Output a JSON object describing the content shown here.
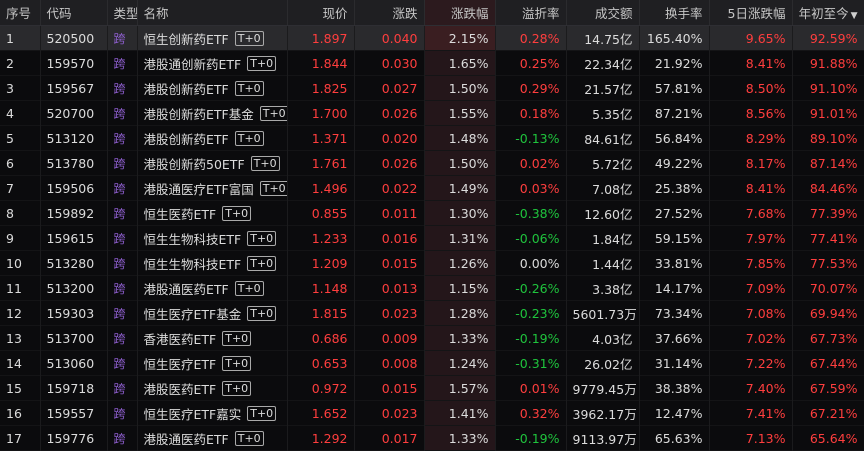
{
  "headers": {
    "seq": "序号",
    "code": "代码",
    "type": "类型",
    "name": "名称",
    "price": "现价",
    "change": "涨跌",
    "change_pct": "涨跌幅",
    "premium": "溢折率",
    "turnover": "成交额",
    "turnover_rate": "换手率",
    "five_day": "5日涨跌幅",
    "ytd": "年初至今"
  },
  "rows": [
    {
      "seq": "1",
      "code": "520500",
      "type": "跨",
      "name": "恒生创新药ETF",
      "badge": "T+0",
      "price": "1.897",
      "change": "0.040",
      "change_pct": "2.15%",
      "premium": "0.28%",
      "premium_dir": "up",
      "turnover": "14.75亿",
      "turnover_rate": "165.40%",
      "five_day": "9.65%",
      "ytd": "92.59%"
    },
    {
      "seq": "2",
      "code": "159570",
      "type": "跨",
      "name": "港股通创新药ETF",
      "badge": "T+0",
      "price": "1.844",
      "change": "0.030",
      "change_pct": "1.65%",
      "premium": "0.25%",
      "premium_dir": "up",
      "turnover": "22.34亿",
      "turnover_rate": "21.92%",
      "five_day": "8.41%",
      "ytd": "91.88%"
    },
    {
      "seq": "3",
      "code": "159567",
      "type": "跨",
      "name": "港股创新药ETF",
      "badge": "T+0",
      "price": "1.825",
      "change": "0.027",
      "change_pct": "1.50%",
      "premium": "0.29%",
      "premium_dir": "up",
      "turnover": "21.57亿",
      "turnover_rate": "57.81%",
      "five_day": "8.50%",
      "ytd": "91.10%"
    },
    {
      "seq": "4",
      "code": "520700",
      "type": "跨",
      "name": "港股创新药ETF基金",
      "badge": "T+0",
      "price": "1.700",
      "change": "0.026",
      "change_pct": "1.55%",
      "premium": "0.18%",
      "premium_dir": "up",
      "turnover": "5.35亿",
      "turnover_rate": "87.21%",
      "five_day": "8.56%",
      "ytd": "91.01%"
    },
    {
      "seq": "5",
      "code": "513120",
      "type": "跨",
      "name": "港股创新药ETF",
      "badge": "T+0",
      "price": "1.371",
      "change": "0.020",
      "change_pct": "1.48%",
      "premium": "-0.13%",
      "premium_dir": "down",
      "turnover": "84.61亿",
      "turnover_rate": "56.84%",
      "five_day": "8.29%",
      "ytd": "89.10%"
    },
    {
      "seq": "6",
      "code": "513780",
      "type": "跨",
      "name": "港股创新药50ETF",
      "badge": "T+0",
      "price": "1.761",
      "change": "0.026",
      "change_pct": "1.50%",
      "premium": "0.02%",
      "premium_dir": "up",
      "turnover": "5.72亿",
      "turnover_rate": "49.22%",
      "five_day": "8.17%",
      "ytd": "87.14%"
    },
    {
      "seq": "7",
      "code": "159506",
      "type": "跨",
      "name": "港股通医疗ETF富国",
      "badge": "T+0",
      "price": "1.496",
      "change": "0.022",
      "change_pct": "1.49%",
      "premium": "0.03%",
      "premium_dir": "up",
      "turnover": "7.08亿",
      "turnover_rate": "25.38%",
      "five_day": "8.41%",
      "ytd": "84.46%"
    },
    {
      "seq": "8",
      "code": "159892",
      "type": "跨",
      "name": "恒生医药ETF",
      "badge": "T+0",
      "price": "0.855",
      "change": "0.011",
      "change_pct": "1.30%",
      "premium": "-0.38%",
      "premium_dir": "down",
      "turnover": "12.60亿",
      "turnover_rate": "27.52%",
      "five_day": "7.68%",
      "ytd": "77.39%"
    },
    {
      "seq": "9",
      "code": "159615",
      "type": "跨",
      "name": "恒生生物科技ETF",
      "badge": "T+0",
      "price": "1.233",
      "change": "0.016",
      "change_pct": "1.31%",
      "premium": "-0.06%",
      "premium_dir": "down",
      "turnover": "1.84亿",
      "turnover_rate": "59.15%",
      "five_day": "7.97%",
      "ytd": "77.41%"
    },
    {
      "seq": "10",
      "code": "513280",
      "type": "跨",
      "name": "恒生生物科技ETF",
      "badge": "T+0",
      "price": "1.209",
      "change": "0.015",
      "change_pct": "1.26%",
      "premium": "0.00%",
      "premium_dir": "flat",
      "turnover": "1.44亿",
      "turnover_rate": "33.81%",
      "five_day": "7.85%",
      "ytd": "77.53%"
    },
    {
      "seq": "11",
      "code": "513200",
      "type": "跨",
      "name": "港股通医药ETF",
      "badge": "T+0",
      "price": "1.148",
      "change": "0.013",
      "change_pct": "1.15%",
      "premium": "-0.26%",
      "premium_dir": "down",
      "turnover": "3.38亿",
      "turnover_rate": "14.17%",
      "five_day": "7.09%",
      "ytd": "70.07%"
    },
    {
      "seq": "12",
      "code": "159303",
      "type": "跨",
      "name": "恒生医疗ETF基金",
      "badge": "T+0",
      "price": "1.815",
      "change": "0.023",
      "change_pct": "1.28%",
      "premium": "-0.23%",
      "premium_dir": "down",
      "turnover": "5601.73万",
      "turnover_rate": "73.34%",
      "five_day": "7.08%",
      "ytd": "69.94%"
    },
    {
      "seq": "13",
      "code": "513700",
      "type": "跨",
      "name": "香港医药ETF",
      "badge": "T+0",
      "price": "0.686",
      "change": "0.009",
      "change_pct": "1.33%",
      "premium": "-0.19%",
      "premium_dir": "down",
      "turnover": "4.03亿",
      "turnover_rate": "37.66%",
      "five_day": "7.02%",
      "ytd": "67.73%"
    },
    {
      "seq": "14",
      "code": "513060",
      "type": "跨",
      "name": "恒生医疗ETF",
      "badge": "T+0",
      "price": "0.653",
      "change": "0.008",
      "change_pct": "1.24%",
      "premium": "-0.31%",
      "premium_dir": "down",
      "turnover": "26.02亿",
      "turnover_rate": "31.14%",
      "five_day": "7.22%",
      "ytd": "67.44%"
    },
    {
      "seq": "15",
      "code": "159718",
      "type": "跨",
      "name": "港股医药ETF",
      "badge": "T+0",
      "price": "0.972",
      "change": "0.015",
      "change_pct": "1.57%",
      "premium": "0.01%",
      "premium_dir": "up",
      "turnover": "9779.45万",
      "turnover_rate": "38.38%",
      "five_day": "7.40%",
      "ytd": "67.59%"
    },
    {
      "seq": "16",
      "code": "159557",
      "type": "跨",
      "name": "恒生医疗ETF嘉实",
      "badge": "T+0",
      "price": "1.652",
      "change": "0.023",
      "change_pct": "1.41%",
      "premium": "0.32%",
      "premium_dir": "up",
      "turnover": "3962.17万",
      "turnover_rate": "12.47%",
      "five_day": "7.41%",
      "ytd": "67.21%"
    },
    {
      "seq": "17",
      "code": "159776",
      "type": "跨",
      "name": "港股通医药ETF",
      "badge": "T+0",
      "price": "1.292",
      "change": "0.017",
      "change_pct": "1.33%",
      "premium": "-0.19%",
      "premium_dir": "down",
      "turnover": "9113.97万",
      "turnover_rate": "65.63%",
      "five_day": "7.13%",
      "ytd": "65.64%"
    }
  ],
  "colors": {
    "up": "#ff3e3e",
    "down": "#1fc43d",
    "flat": "#dcdcdc",
    "type_tag": "#8f5fd0",
    "background": "#0b0b0d",
    "header_bg": "#1f1f22"
  },
  "selected_row": 0,
  "sorted_column": "ytd",
  "sort_direction": "desc"
}
